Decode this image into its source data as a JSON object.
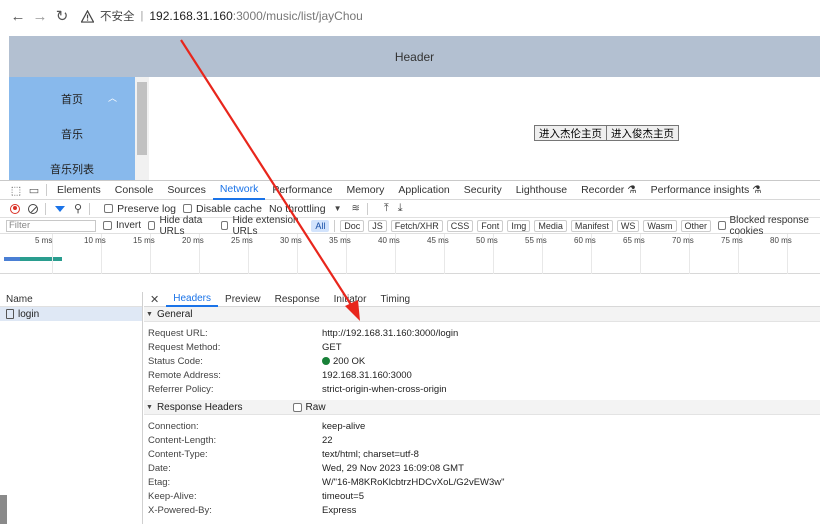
{
  "browser": {
    "insecure_label": "不安全",
    "url_host": "192.168.31.160",
    "url_path": ":3000/music/list/jayChou"
  },
  "page": {
    "header": "Header",
    "menu": [
      {
        "label": "首页"
      },
      {
        "label": "音乐"
      },
      {
        "label": "音乐列表"
      }
    ],
    "buttons": [
      "进入杰伦主页",
      "进入俊杰主页"
    ]
  },
  "devtools": {
    "tabs": [
      "Elements",
      "Console",
      "Sources",
      "Network",
      "Performance",
      "Memory",
      "Application",
      "Security",
      "Lighthouse",
      "Recorder ⚗",
      "Performance insights ⚗"
    ],
    "active_tab": "Network",
    "toolbar": {
      "preserve_log": "Preserve log",
      "disable_cache": "Disable cache",
      "throttling": "No throttling"
    },
    "filterbar": {
      "placeholder": "Filter",
      "invert": "Invert",
      "hide_data_urls": "Hide data URLs",
      "hide_extension_urls": "Hide extension URLs",
      "types": [
        "All",
        "Doc",
        "JS",
        "Fetch/XHR",
        "CSS",
        "Font",
        "Img",
        "Media",
        "Manifest",
        "WS",
        "Wasm",
        "Other"
      ],
      "active_type": "All",
      "blocked_cookies": "Blocked response cookies"
    },
    "timeline_ticks": [
      "5 ms",
      "10 ms",
      "15 ms",
      "20 ms",
      "25 ms",
      "30 ms",
      "35 ms",
      "40 ms",
      "45 ms",
      "50 ms",
      "55 ms",
      "60 ms",
      "65 ms",
      "70 ms",
      "75 ms",
      "80 ms"
    ],
    "names_header": "Name",
    "requests": [
      {
        "name": "login"
      }
    ],
    "detail_tabs": [
      "Headers",
      "Preview",
      "Response",
      "Initiator",
      "Timing"
    ],
    "active_detail_tab": "Headers",
    "general": {
      "title": "General",
      "rows": [
        {
          "k": "Request URL:",
          "v": "http://192.168.31.160:3000/login"
        },
        {
          "k": "Request Method:",
          "v": "GET"
        },
        {
          "k": "Status Code:",
          "v": "200 OK"
        },
        {
          "k": "Remote Address:",
          "v": "192.168.31.160:3000"
        },
        {
          "k": "Referrer Policy:",
          "v": "strict-origin-when-cross-origin"
        }
      ]
    },
    "response_headers": {
      "title": "Response Headers",
      "raw_label": "Raw",
      "rows": [
        {
          "k": "Connection:",
          "v": "keep-alive"
        },
        {
          "k": "Content-Length:",
          "v": "22"
        },
        {
          "k": "Content-Type:",
          "v": "text/html; charset=utf-8"
        },
        {
          "k": "Date:",
          "v": "Wed, 29 Nov 2023 16:09:08 GMT"
        },
        {
          "k": "Etag:",
          "v": "W/\"16-M8KRoKlcbtrzHDCvXoL/G2vEW3w\""
        },
        {
          "k": "Keep-Alive:",
          "v": "timeout=5"
        },
        {
          "k": "X-Powered-By:",
          "v": "Express"
        }
      ]
    }
  },
  "colors": {
    "header_bg": "#b3c0d1",
    "aside_bg": "#88b9ec",
    "accent": "#1a73e8",
    "annotation_arrow": "#e8261c"
  }
}
